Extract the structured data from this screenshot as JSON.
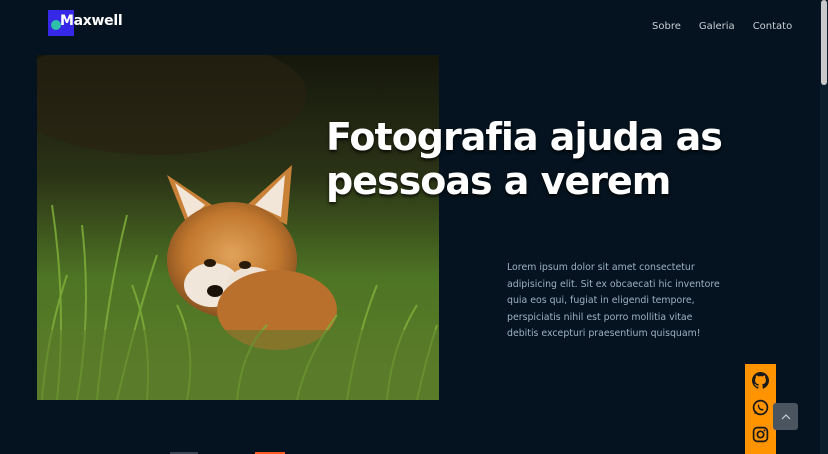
{
  "brand": {
    "logo_text": "Maxwell"
  },
  "nav": {
    "items": [
      {
        "label": "Sobre"
      },
      {
        "label": "Galeria"
      },
      {
        "label": "Contato"
      }
    ]
  },
  "hero": {
    "headline": "Fotografia ajuda as pessoas a verem",
    "body": "Lorem ipsum dolor sit amet consectetur adipisicing elit. Sit ex obcaecati hic inventore quia eos qui, fugiat in eligendi tempore, perspiciatis nihil est porro mollitia vitae debitis excepturi praesentium quisquam!"
  },
  "social": {
    "icons": [
      "github-icon",
      "whatsapp-icon",
      "instagram-icon"
    ]
  },
  "colors": {
    "background": "#04131f",
    "social_bar": "#ff9300",
    "logo_square": "#3528e6",
    "logo_dot": "#2ec0a8"
  }
}
